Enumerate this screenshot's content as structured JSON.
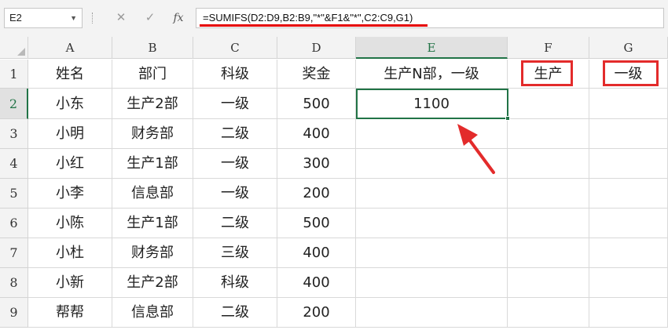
{
  "formula_bar": {
    "name_box": "E2",
    "cancel_glyph": "✕",
    "enter_glyph": "✓",
    "fx_label": "fx",
    "formula": "=SUMIFS(D2:D9,B2:B9,\"*\"&F1&\"*\",C2:C9,G1)"
  },
  "columns": [
    "A",
    "B",
    "C",
    "D",
    "E",
    "F",
    "G"
  ],
  "rows": [
    "1",
    "2",
    "3",
    "4",
    "5",
    "6",
    "7",
    "8",
    "9"
  ],
  "header_row": {
    "A": "姓名",
    "B": "部门",
    "C": "科级",
    "D": "奖金",
    "E": "生产N部，一级",
    "F": "生产",
    "G": "一级"
  },
  "data_rows": [
    {
      "A": "小东",
      "B": "生产2部",
      "C": "一级",
      "D": "500",
      "E": "1100"
    },
    {
      "A": "小明",
      "B": "财务部",
      "C": "二级",
      "D": "400",
      "E": ""
    },
    {
      "A": "小红",
      "B": "生产1部",
      "C": "一级",
      "D": "300",
      "E": ""
    },
    {
      "A": "小李",
      "B": "信息部",
      "C": "一级",
      "D": "200",
      "E": ""
    },
    {
      "A": "小陈",
      "B": "生产1部",
      "C": "二级",
      "D": "500",
      "E": ""
    },
    {
      "A": "小杜",
      "B": "财务部",
      "C": "三级",
      "D": "400",
      "E": ""
    },
    {
      "A": "小新",
      "B": "生产2部",
      "C": "科级",
      "D": "400",
      "E": ""
    },
    {
      "A": "帮帮",
      "B": "信息部",
      "C": "二级",
      "D": "200",
      "E": ""
    }
  ],
  "selection": {
    "cell": "E2",
    "accent": "#217346"
  },
  "annotation_color": "#e32b2b"
}
